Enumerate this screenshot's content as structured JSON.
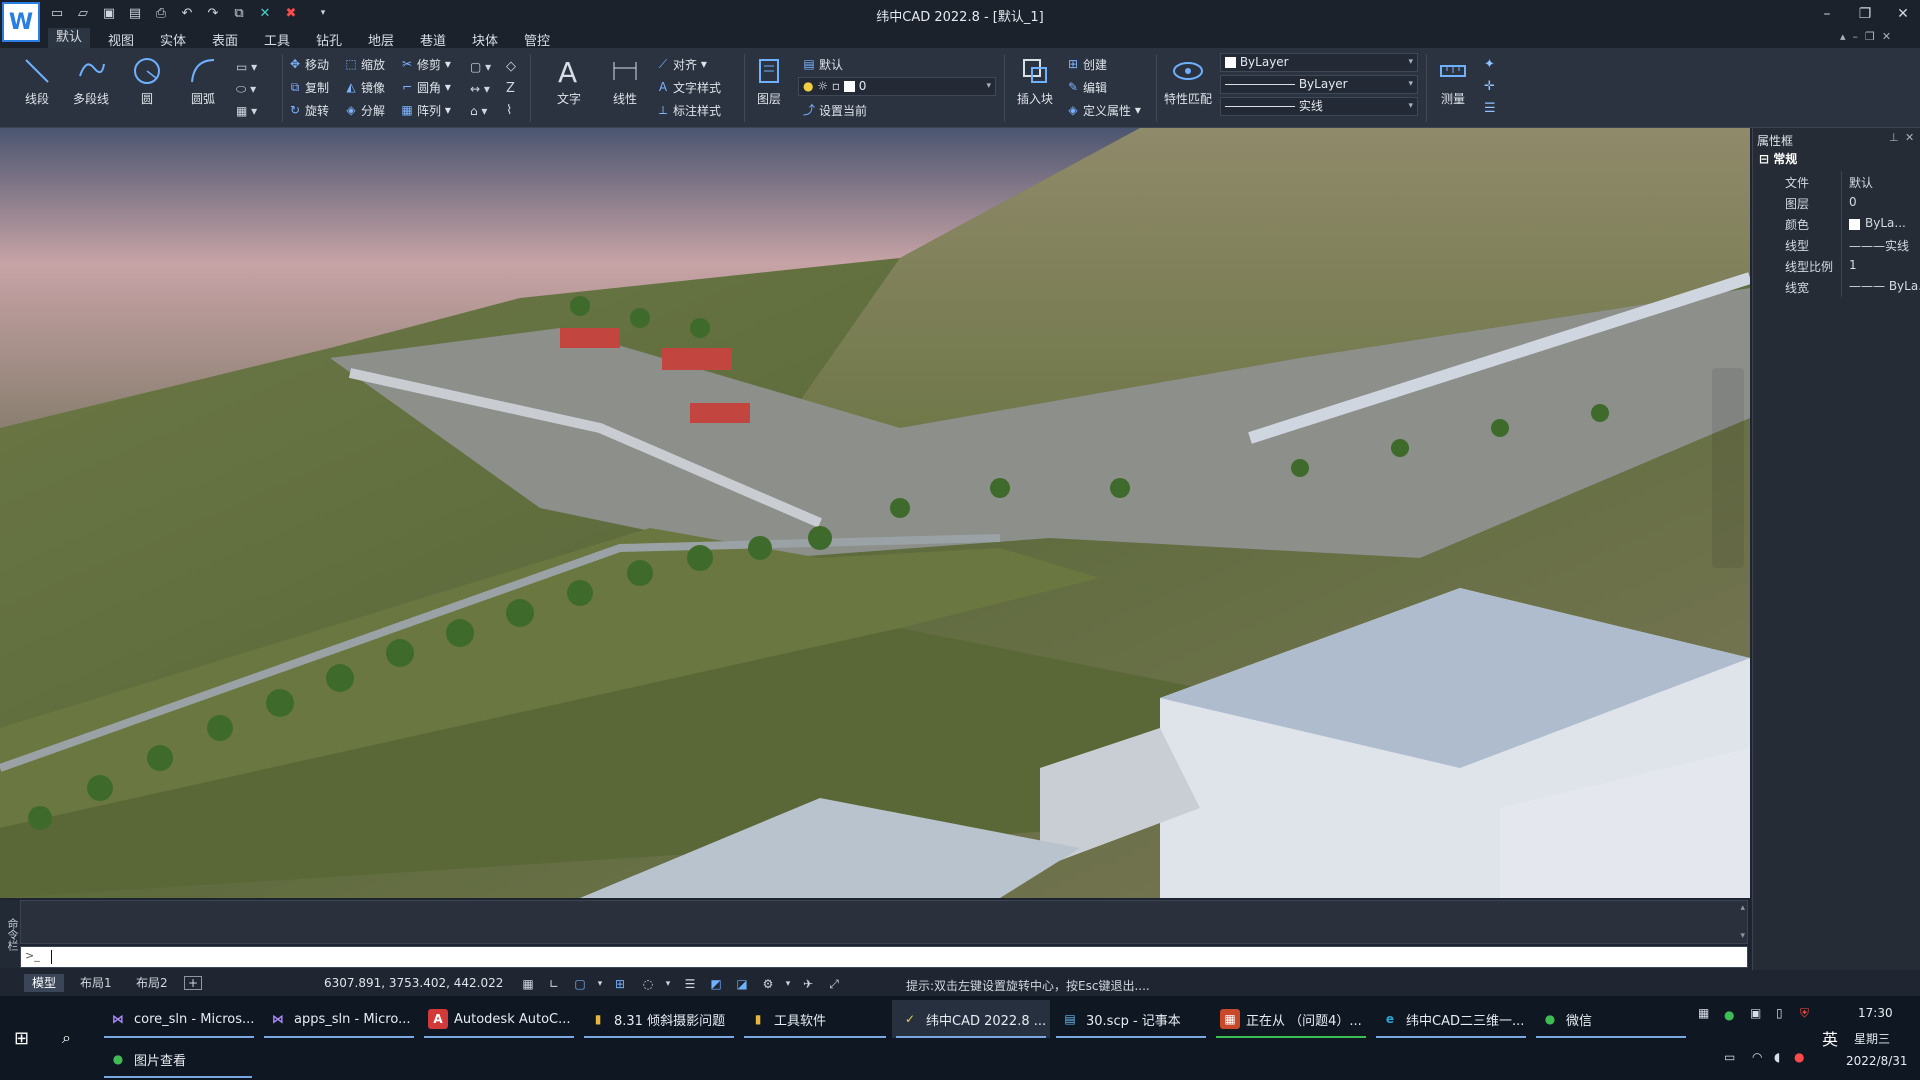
{
  "app": {
    "title": "纬中CAD  2022.8 - [默认_1]",
    "logo_glyph": "W"
  },
  "quick_access": [
    "new-icon",
    "open-icon",
    "save-icon",
    "saveas-icon",
    "print-icon",
    "undo-icon",
    "redo-icon",
    "window-icon",
    "close-doc-icon",
    "close-all-icon",
    "more-icon"
  ],
  "window_controls": {
    "minimize": "–",
    "restore": "❐",
    "close": "✕"
  },
  "menu": [
    "默认",
    "视图",
    "实体",
    "表面",
    "工具",
    "钻孔",
    "地层",
    "巷道",
    "块体",
    "管控"
  ],
  "ribbon": {
    "draw": {
      "line": "线段",
      "polyline": "多段线",
      "circle": "圆",
      "arc": "圆弧"
    },
    "modify": {
      "move": "移动",
      "copy": "复制",
      "rotate": "旋转",
      "scale": "缩放",
      "mirror": "镜像",
      "explode": "分解",
      "trim": "修剪",
      "fillet": "圆角",
      "array": "阵列"
    },
    "annotation": {
      "text": "文字",
      "linear": "线性",
      "align": "对齐",
      "text_style": "文字样式",
      "dim_style": "标注样式"
    },
    "layers": {
      "layer_btn": "图层",
      "current_layer": "默认",
      "layer_state": "0",
      "set_current": "设置当前"
    },
    "block": {
      "insert": "插入块",
      "create": "创建",
      "edit": "编辑",
      "define_attr": "定义属性"
    },
    "properties": {
      "match": "特性匹配",
      "color": "ByLayer",
      "linetype": "ByLayer",
      "lineweight": "实线"
    },
    "utilities": {
      "measure": "测量"
    }
  },
  "property_panel": {
    "title": "属性框",
    "section": "常规",
    "rows": [
      {
        "key": "文件",
        "value": "默认"
      },
      {
        "key": "图层",
        "value": "0"
      },
      {
        "key": "颜色",
        "value": "ByLa..."
      },
      {
        "key": "线型",
        "value": "———实线"
      },
      {
        "key": "线型比例",
        "value": "1"
      },
      {
        "key": "线宽",
        "value": "——— ByLa..."
      }
    ]
  },
  "command": {
    "side_label": "命令栏",
    "prompt_icon": ">_",
    "input_value": ""
  },
  "layout_tabs": [
    "模型",
    "布局1",
    "布局2"
  ],
  "add_tab": "+",
  "status": {
    "coordinates": "6307.891, 3753.402, 442.022",
    "hint": "提示:双击左键设置旋转中心，按Esc键退出...."
  },
  "taskbar": {
    "apps": [
      {
        "label": "core_sln - Micros...",
        "icon_color": "#8f6bd6",
        "glyph": "⋈"
      },
      {
        "label": "apps_sln - Micro...",
        "icon_color": "#8f6bd6",
        "glyph": "⋈"
      },
      {
        "label": "Autodesk AutoC...",
        "icon_color": "#d23a3a",
        "glyph": "A"
      },
      {
        "label": "8.31 倾斜摄影问题",
        "icon_color": "#e8b73a",
        "glyph": "▮"
      },
      {
        "label": "工具软件",
        "icon_color": "#e8b73a",
        "glyph": "▮"
      },
      {
        "label": "纬中CAD  2022.8 ...",
        "icon_color": "#2a7de1",
        "glyph": "✓"
      },
      {
        "label": "30.scp - 记事本",
        "icon_color": "#6fb7e8",
        "glyph": "▤"
      },
      {
        "label": "正在从 （问题4）...",
        "icon_color": "#c8482a",
        "glyph": "▦"
      },
      {
        "label": "纬中CAD二三维一...",
        "icon_color": "#2aa6d6",
        "glyph": "e"
      },
      {
        "label": "微信",
        "icon_color": "#3ebd55",
        "glyph": "●"
      }
    ],
    "second_row": {
      "label": "图片查看",
      "icon_color": "#3ebd55",
      "glyph": "●"
    },
    "ime": "英",
    "time": "17:30",
    "weekday": "星期三",
    "date": "2022/8/31"
  },
  "colors": {
    "accent": "#2a7de1",
    "ribbon_bg": "#2b3340",
    "panel_bg": "#252c36",
    "taskbar_bg": "#0f1722"
  }
}
